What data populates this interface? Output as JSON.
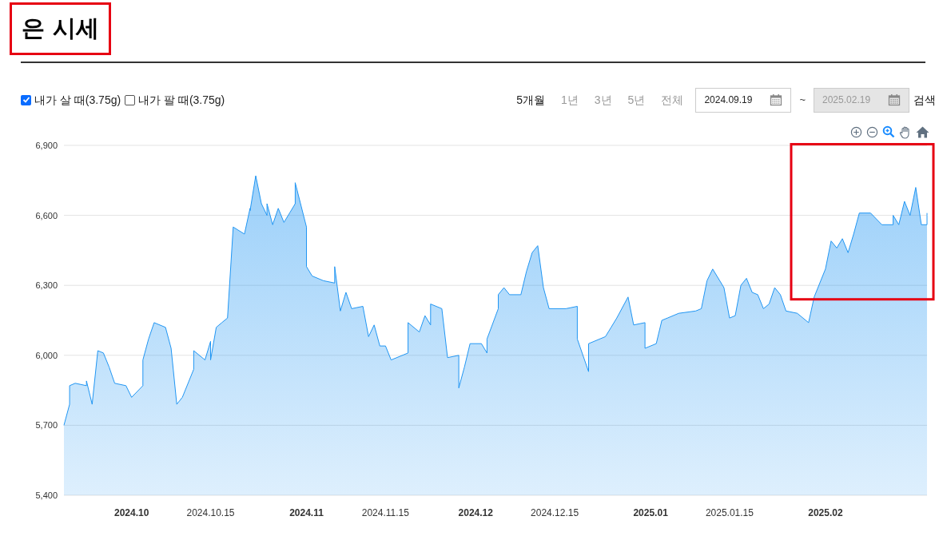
{
  "title": {
    "text": "은 시세",
    "highlighted": true
  },
  "filters": [
    {
      "label": "내가 살 때(3.75g)",
      "checked": true
    },
    {
      "label": "내가 팔 때(3.75g)",
      "checked": false
    }
  ],
  "periods": [
    {
      "label": "5개월",
      "selected": true
    },
    {
      "label": "1년",
      "selected": false
    },
    {
      "label": "3년",
      "selected": false
    },
    {
      "label": "5년",
      "selected": false
    },
    {
      "label": "전체",
      "selected": false
    }
  ],
  "date_from": {
    "value": "2024.09.19",
    "disabled": false
  },
  "separator": "~",
  "date_to": {
    "value": "2025.02.19",
    "disabled": true
  },
  "search_button": "검색",
  "chart_highlighted": true,
  "chart_data": {
    "type": "area",
    "grid": true,
    "xlim": [
      "2024-09-19",
      "2025-02-19"
    ],
    "ylim": [
      5400,
      6900
    ],
    "yticks": [
      {
        "value": 5400,
        "label": "5,400"
      },
      {
        "value": 5700,
        "label": "5,700"
      },
      {
        "value": 6000,
        "label": "6,000"
      },
      {
        "value": 6300,
        "label": "6,300"
      },
      {
        "value": 6600,
        "label": "6,600"
      },
      {
        "value": 6900,
        "label": "6,900"
      }
    ],
    "xticks": [
      {
        "value": "2024-10-01",
        "label": "2024.10"
      },
      {
        "value": "2024-10-15",
        "label": "2024.10.15"
      },
      {
        "value": "2024-11-01",
        "label": "2024.11"
      },
      {
        "value": "2024-11-15",
        "label": "2024.11.15"
      },
      {
        "value": "2024-12-01",
        "label": "2024.12"
      },
      {
        "value": "2024-12-15",
        "label": "2024.12.15"
      },
      {
        "value": "2025-01-01",
        "label": "2025.01"
      },
      {
        "value": "2025-01-15",
        "label": "2025.01.15"
      },
      {
        "value": "2025-02-01",
        "label": "2025.02"
      }
    ],
    "x": [
      "2024-09-19",
      "2024-09-20",
      "2024-09-20",
      "2024-09-21",
      "2024-09-23",
      "2024-09-23",
      "2024-09-24",
      "2024-09-25",
      "2024-09-26",
      "2024-09-27",
      "2024-09-28",
      "2024-09-30",
      "2024-10-01",
      "2024-10-03",
      "2024-10-03",
      "2024-10-04",
      "2024-10-05",
      "2024-10-07",
      "2024-10-08",
      "2024-10-09",
      "2024-10-10",
      "2024-10-12",
      "2024-10-12",
      "2024-10-14",
      "2024-10-15",
      "2024-10-15",
      "2024-10-16",
      "2024-10-17",
      "2024-10-18",
      "2024-10-19",
      "2024-10-21",
      "2024-10-22",
      "2024-10-22",
      "2024-10-23",
      "2024-10-24",
      "2024-10-25",
      "2024-10-25",
      "2024-10-26",
      "2024-10-27",
      "2024-10-28",
      "2024-10-29",
      "2024-10-30",
      "2024-10-30",
      "2024-11-01",
      "2024-11-01",
      "2024-11-02",
      "2024-11-04",
      "2024-11-06",
      "2024-11-06",
      "2024-11-07",
      "2024-11-08",
      "2024-11-09",
      "2024-11-11",
      "2024-11-12",
      "2024-11-13",
      "2024-11-14",
      "2024-11-15",
      "2024-11-16",
      "2024-11-19",
      "2024-11-19",
      "2024-11-21",
      "2024-11-22",
      "2024-11-23",
      "2024-11-23",
      "2024-11-25",
      "2024-11-26",
      "2024-11-28",
      "2024-11-28",
      "2024-11-29",
      "2024-11-30",
      "2024-12-02",
      "2024-12-03",
      "2024-12-03",
      "2024-12-05",
      "2024-12-05",
      "2024-12-06",
      "2024-12-07",
      "2024-12-09",
      "2024-12-10",
      "2024-12-11",
      "2024-12-12",
      "2024-12-13",
      "2024-12-14",
      "2024-12-17",
      "2024-12-19",
      "2024-12-19",
      "2024-12-21",
      "2024-12-21",
      "2024-12-24",
      "2024-12-25",
      "2024-12-26",
      "2024-12-28",
      "2024-12-29",
      "2024-12-31",
      "2024-12-31",
      "2025-01-02",
      "2025-01-03",
      "2025-01-04",
      "2025-01-06",
      "2025-01-09",
      "2025-01-10",
      "2025-01-11",
      "2025-01-12",
      "2025-01-14",
      "2025-01-15",
      "2025-01-16",
      "2025-01-17",
      "2025-01-18",
      "2025-01-19",
      "2025-01-20",
      "2025-01-21",
      "2025-01-22",
      "2025-01-23",
      "2025-01-24",
      "2025-01-25",
      "2025-01-27",
      "2025-01-29",
      "2025-01-30",
      "2025-02-01",
      "2025-02-02",
      "2025-02-03",
      "2025-02-04",
      "2025-02-05",
      "2025-02-06",
      "2025-02-07",
      "2025-02-09",
      "2025-02-11",
      "2025-02-13",
      "2025-02-13",
      "2025-02-14",
      "2025-02-15",
      "2025-02-16",
      "2025-02-17",
      "2025-02-18",
      "2025-02-19",
      "2025-02-19",
      "2025-02-19"
    ],
    "series": [
      {
        "color": "#2196f3",
        "values": [
          5700,
          5790,
          5870,
          5880,
          5870,
          5890,
          5790,
          6020,
          6010,
          5950,
          5880,
          5870,
          5820,
          5870,
          5980,
          6070,
          6140,
          6120,
          6030,
          5790,
          5820,
          5940,
          6020,
          5980,
          6060,
          5980,
          6120,
          6140,
          6160,
          6550,
          6520,
          6630,
          6620,
          6770,
          6650,
          6600,
          6650,
          6560,
          6630,
          6570,
          6610,
          6650,
          6740,
          6550,
          6380,
          6340,
          6320,
          6310,
          6380,
          6190,
          6270,
          6200,
          6210,
          6080,
          6130,
          6040,
          6040,
          5980,
          6010,
          6140,
          6100,
          6170,
          6130,
          6220,
          6200,
          5990,
          6000,
          5860,
          5950,
          6050,
          6050,
          6010,
          6070,
          6200,
          6260,
          6290,
          6260,
          6260,
          6360,
          6440,
          6470,
          6290,
          6200,
          6200,
          6210,
          6070,
          5930,
          6050,
          6080,
          6120,
          6160,
          6250,
          6130,
          6140,
          6030,
          6050,
          6150,
          6160,
          6180,
          6190,
          6200,
          6320,
          6370,
          6290,
          6160,
          6170,
          6300,
          6330,
          6270,
          6260,
          6200,
          6220,
          6290,
          6260,
          6190,
          6180,
          6140,
          6250,
          6370,
          6490,
          6460,
          6500,
          6440,
          6520,
          6610,
          6610,
          6560,
          6560,
          6600,
          6560,
          6660,
          6600,
          6720,
          6560,
          6560,
          6600,
          6610
        ]
      }
    ]
  }
}
